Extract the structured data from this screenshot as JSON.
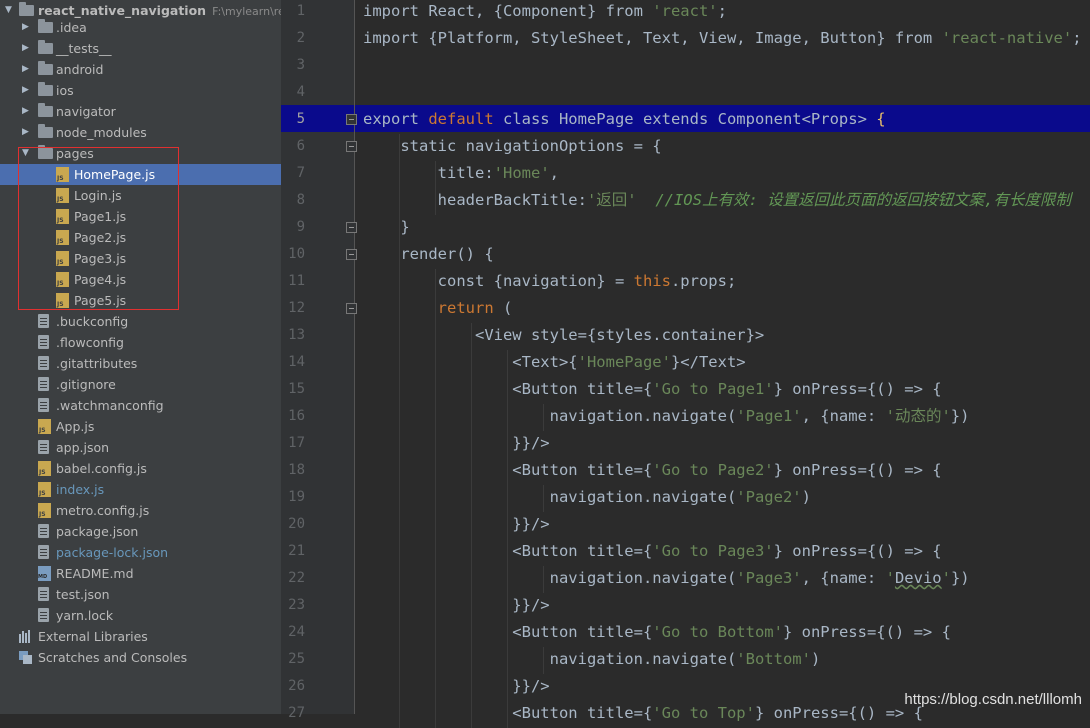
{
  "project": {
    "name": "react_native_navigation",
    "path": "F:\\mylearn\\reac"
  },
  "tree": [
    {
      "label": ".idea",
      "type": "folder"
    },
    {
      "label": "__tests__",
      "type": "folder"
    },
    {
      "label": "android",
      "type": "folder"
    },
    {
      "label": "ios",
      "type": "folder"
    },
    {
      "label": "navigator",
      "type": "folder"
    },
    {
      "label": "node_modules",
      "type": "folder"
    },
    {
      "label": "pages",
      "type": "folder-open"
    },
    {
      "label": "HomePage.js",
      "type": "js",
      "indent": 2,
      "selected": true
    },
    {
      "label": "Login.js",
      "type": "js",
      "indent": 2
    },
    {
      "label": "Page1.js",
      "type": "js",
      "indent": 2
    },
    {
      "label": "Page2.js",
      "type": "js",
      "indent": 2
    },
    {
      "label": "Page3.js",
      "type": "js",
      "indent": 2
    },
    {
      "label": "Page4.js",
      "type": "js",
      "indent": 2
    },
    {
      "label": "Page5.js",
      "type": "js",
      "indent": 2
    },
    {
      "label": ".buckconfig",
      "type": "file"
    },
    {
      "label": ".flowconfig",
      "type": "file"
    },
    {
      "label": ".gitattributes",
      "type": "file"
    },
    {
      "label": ".gitignore",
      "type": "file"
    },
    {
      "label": ".watchmanconfig",
      "type": "file"
    },
    {
      "label": "App.js",
      "type": "js"
    },
    {
      "label": "app.json",
      "type": "file"
    },
    {
      "label": "babel.config.js",
      "type": "js"
    },
    {
      "label": "index.js",
      "type": "js",
      "blue": true
    },
    {
      "label": "metro.config.js",
      "type": "js"
    },
    {
      "label": "package.json",
      "type": "file"
    },
    {
      "label": "package-lock.json",
      "type": "file",
      "blue": true
    },
    {
      "label": "README.md",
      "type": "md"
    },
    {
      "label": "test.json",
      "type": "file"
    },
    {
      "label": "yarn.lock",
      "type": "file"
    }
  ],
  "extras": {
    "external_libraries": "External Libraries",
    "scratches": "Scratches and Consoles"
  },
  "editor": {
    "current_line": 5,
    "lines": [
      [
        [
          "kw0",
          "import React, {Component} from "
        ],
        [
          "str",
          "'react'"
        ],
        [
          "kw0",
          ";"
        ]
      ],
      [
        [
          "kw0",
          "import {Platform, StyleSheet, Text, View, Image, Button} from "
        ],
        [
          "str",
          "'react-native'"
        ],
        [
          "kw0",
          ";"
        ]
      ],
      [],
      [],
      [
        [
          "kw0",
          "export "
        ],
        [
          "kw",
          "default "
        ],
        [
          "kw0",
          "class HomePage extends Component<Props> "
        ],
        [
          "tag",
          "{"
        ]
      ],
      [
        [
          "kw0",
          "    static navigationOptions = {"
        ]
      ],
      [
        [
          "kw0",
          "        title:"
        ],
        [
          "str",
          "'Home'"
        ],
        [
          "kw0",
          ","
        ]
      ],
      [
        [
          "kw0",
          "        headerBackTitle:"
        ],
        [
          "str",
          "'返回'"
        ],
        [
          "kw0",
          "  "
        ],
        [
          "cmt",
          "//IOS上有效: 设置返回此页面的返回按钮文案,有长度限制"
        ]
      ],
      [
        [
          "kw0",
          "    }"
        ]
      ],
      [
        [
          "kw0",
          "    render() {"
        ]
      ],
      [
        [
          "kw0",
          "        const {navigation} = "
        ],
        [
          "kw",
          "this"
        ],
        [
          "kw0",
          ".props;"
        ]
      ],
      [
        [
          "kw0",
          "        "
        ],
        [
          "kw",
          "return"
        ],
        [
          "kw0",
          " ("
        ]
      ],
      [
        [
          "kw0",
          "            <View style={styles.container}>"
        ]
      ],
      [
        [
          "kw0",
          "                <Text>{"
        ],
        [
          "str",
          "'HomePage'"
        ],
        [
          "kw0",
          "}</Text>"
        ]
      ],
      [
        [
          "kw0",
          "                <Button title={"
        ],
        [
          "str",
          "'Go to Page1'"
        ],
        [
          "kw0",
          "} onPress={() => {"
        ]
      ],
      [
        [
          "kw0",
          "                    navigation.navigate("
        ],
        [
          "str",
          "'Page1'"
        ],
        [
          "kw0",
          ", {name: "
        ],
        [
          "str",
          "'动态的'"
        ],
        [
          "kw0",
          "})"
        ]
      ],
      [
        [
          "kw0",
          "                }}/>"
        ]
      ],
      [
        [
          "kw0",
          "                <Button title={"
        ],
        [
          "str",
          "'Go to Page2'"
        ],
        [
          "kw0",
          "} onPress={() => {"
        ]
      ],
      [
        [
          "kw0",
          "                    navigation.navigate("
        ],
        [
          "str",
          "'Page2'"
        ],
        [
          "kw0",
          ")"
        ]
      ],
      [
        [
          "kw0",
          "                }}/>"
        ]
      ],
      [
        [
          "kw0",
          "                <Button title={"
        ],
        [
          "str",
          "'Go to Page3'"
        ],
        [
          "kw0",
          "} onPress={() => {"
        ]
      ],
      [
        [
          "kw0",
          "                    navigation.navigate("
        ],
        [
          "str",
          "'Page3'"
        ],
        [
          "kw0",
          ", {name: "
        ],
        [
          "str",
          "'"
        ],
        [
          "under",
          "Devio"
        ],
        [
          "str",
          "'"
        ],
        [
          "kw0",
          "})"
        ]
      ],
      [
        [
          "kw0",
          "                }}/>"
        ]
      ],
      [
        [
          "kw0",
          "                <Button title={"
        ],
        [
          "str",
          "'Go to Bottom'"
        ],
        [
          "kw0",
          "} onPress={() => {"
        ]
      ],
      [
        [
          "kw0",
          "                    navigation.navigate("
        ],
        [
          "str",
          "'Bottom'"
        ],
        [
          "kw0",
          ")"
        ]
      ],
      [
        [
          "kw0",
          "                }}/>"
        ]
      ],
      [
        [
          "kw0",
          "                <Button title={"
        ],
        [
          "str",
          "'Go to Top'"
        ],
        [
          "kw0",
          "} onPress={() => {"
        ]
      ]
    ]
  },
  "watermark": "https://blog.csdn.net/lllomh"
}
